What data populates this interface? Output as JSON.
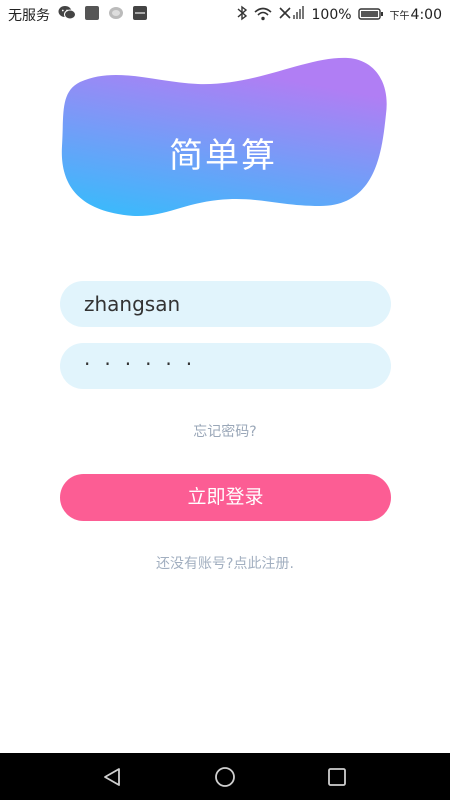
{
  "status_bar": {
    "carrier": "无服务",
    "battery": "100%",
    "time_prefix": "下午",
    "time": "4:00"
  },
  "logo": {
    "title": "简单算",
    "gradient_start": "#b07ef4",
    "gradient_end": "#3eb8fb"
  },
  "login_form": {
    "username_value": "zhangsan",
    "password_masked": "······",
    "forgot_password": "忘记密码?",
    "login_button": "立即登录",
    "register_prompt": "还没有账号?点此注册."
  },
  "colors": {
    "field_bg": "#e1f4fc",
    "button_bg": "#fc5d94",
    "link_text": "#9aa7b8"
  },
  "icons": [
    "wechat-icon",
    "app-icon",
    "bluetooth-icon",
    "wifi-icon",
    "signal-icon",
    "battery-icon",
    "back-icon",
    "home-icon",
    "recent-apps-icon"
  ]
}
